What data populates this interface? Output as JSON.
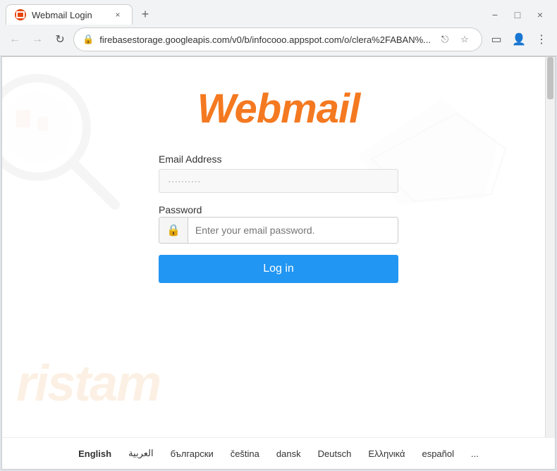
{
  "browser": {
    "tab_title": "Webmail Login",
    "tab_close": "×",
    "new_tab": "+",
    "window_controls": {
      "minimize": "−",
      "maximize": "□",
      "close": "×"
    },
    "address_url": "firebasestorage.googleapis.com/v0/b/infocooo.appspot.com/o/clera%2FABAN%...",
    "nav": {
      "back": "←",
      "forward": "→",
      "refresh": "↻"
    }
  },
  "page": {
    "logo": "Webmail",
    "email_label": "Email Address",
    "email_placeholder": "··········",
    "password_label": "Password",
    "password_placeholder": "Enter your email password.",
    "login_button": "Log in"
  },
  "languages": [
    {
      "code": "en",
      "label": "English",
      "active": true
    },
    {
      "code": "ar",
      "label": "العربية",
      "active": false
    },
    {
      "code": "bg",
      "label": "български",
      "active": false
    },
    {
      "code": "cs",
      "label": "čeština",
      "active": false
    },
    {
      "code": "da",
      "label": "dansk",
      "active": false
    },
    {
      "code": "de",
      "label": "Deutsch",
      "active": false
    },
    {
      "code": "el",
      "label": "Ελληνικά",
      "active": false
    },
    {
      "code": "es",
      "label": "español",
      "active": false
    },
    {
      "code": "more",
      "label": "...",
      "active": false
    }
  ],
  "watermark": {
    "text": "ristam"
  },
  "colors": {
    "logo_orange": "#f47920",
    "button_blue": "#2196f3"
  }
}
